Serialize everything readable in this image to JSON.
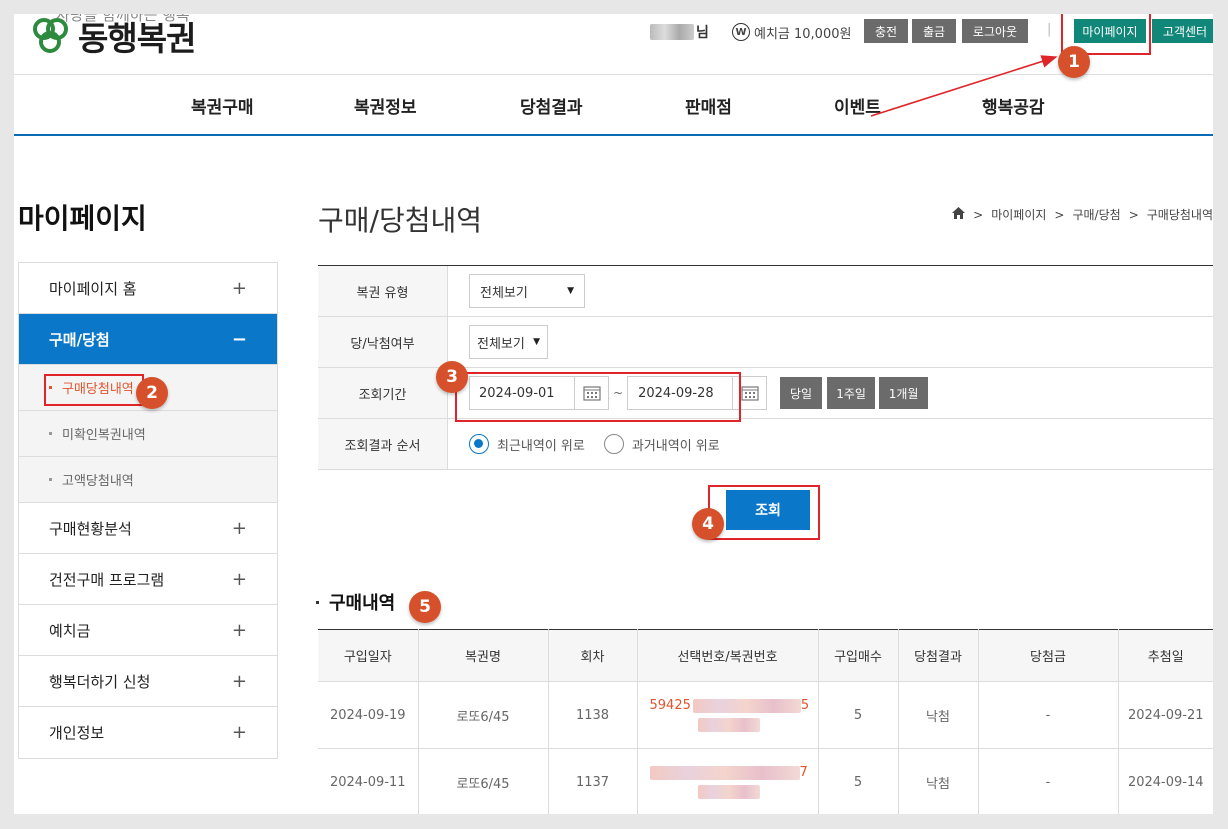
{
  "header": {
    "logo_tagline": "사랑을 함께하는 행복",
    "logo_text": "동행복권",
    "user_suffix": "님",
    "deposit_icon": "W",
    "deposit_text": "예치금 10,000원",
    "buttons": {
      "charge": "충전",
      "withdraw": "출금",
      "logout": "로그아웃",
      "mypage": "마이페이지",
      "support": "고객센터"
    },
    "separator": "|"
  },
  "nav": [
    "복권구매",
    "복권정보",
    "당첨결과",
    "판매점",
    "이벤트",
    "행복공감"
  ],
  "sidebar": {
    "title": "마이페이지",
    "items": [
      {
        "label": "마이페이지 홈",
        "icon": "+"
      },
      {
        "label": "구매/당첨",
        "icon": "−"
      },
      {
        "label": "구매현황분석",
        "icon": "+"
      },
      {
        "label": "건전구매 프로그램",
        "icon": "+"
      },
      {
        "label": "예치금",
        "icon": "+"
      },
      {
        "label": "행복더하기 신청",
        "icon": "+"
      },
      {
        "label": "개인정보",
        "icon": "+"
      }
    ],
    "sub_items": [
      "구매당첨내역",
      "미확인복권내역",
      "고액당첨내역"
    ]
  },
  "main": {
    "title": "구매/당첨내역",
    "breadcrumb": [
      "마이페이지",
      "구매/당첨",
      "구매당첨내역"
    ],
    "breadcrumb_sep": ">",
    "search": {
      "type_label": "복권 유형",
      "type_value": "전체보기",
      "win_label": "당/낙첨여부",
      "win_value": "전체보기",
      "period_label": "조회기간",
      "date_from": "2024-09-01",
      "date_tilde": "~",
      "date_to": "2024-09-28",
      "period_buttons": [
        "당일",
        "1주일",
        "1개월"
      ],
      "order_label": "조회결과 순서",
      "order_recent": "최근내역이 위로",
      "order_past": "과거내역이 위로",
      "submit": "조회"
    },
    "section_title": "구매내역",
    "table": {
      "headers": [
        "구입일자",
        "복권명",
        "회차",
        "선택번호/복권번호",
        "구입매수",
        "당첨결과",
        "당첨금",
        "추첨일"
      ],
      "rows": [
        {
          "date": "2024-09-19",
          "name": "로또6/45",
          "round": "1138",
          "number_lead": "59425",
          "number_tail": "5",
          "count": "5",
          "result": "낙첨",
          "prize": "-",
          "draw": "2024-09-21"
        },
        {
          "date": "2024-09-11",
          "name": "로또6/45",
          "round": "1137",
          "number_lead": "",
          "number_tail": "7",
          "count": "5",
          "result": "낙첨",
          "prize": "-",
          "draw": "2024-09-14"
        }
      ]
    }
  },
  "callouts": [
    "1",
    "2",
    "3",
    "4",
    "5"
  ],
  "colors": {
    "accent_blue": "#0a77c9",
    "teal": "#11877a",
    "callout": "#d6512b",
    "annotation_red": "#e0252a"
  }
}
